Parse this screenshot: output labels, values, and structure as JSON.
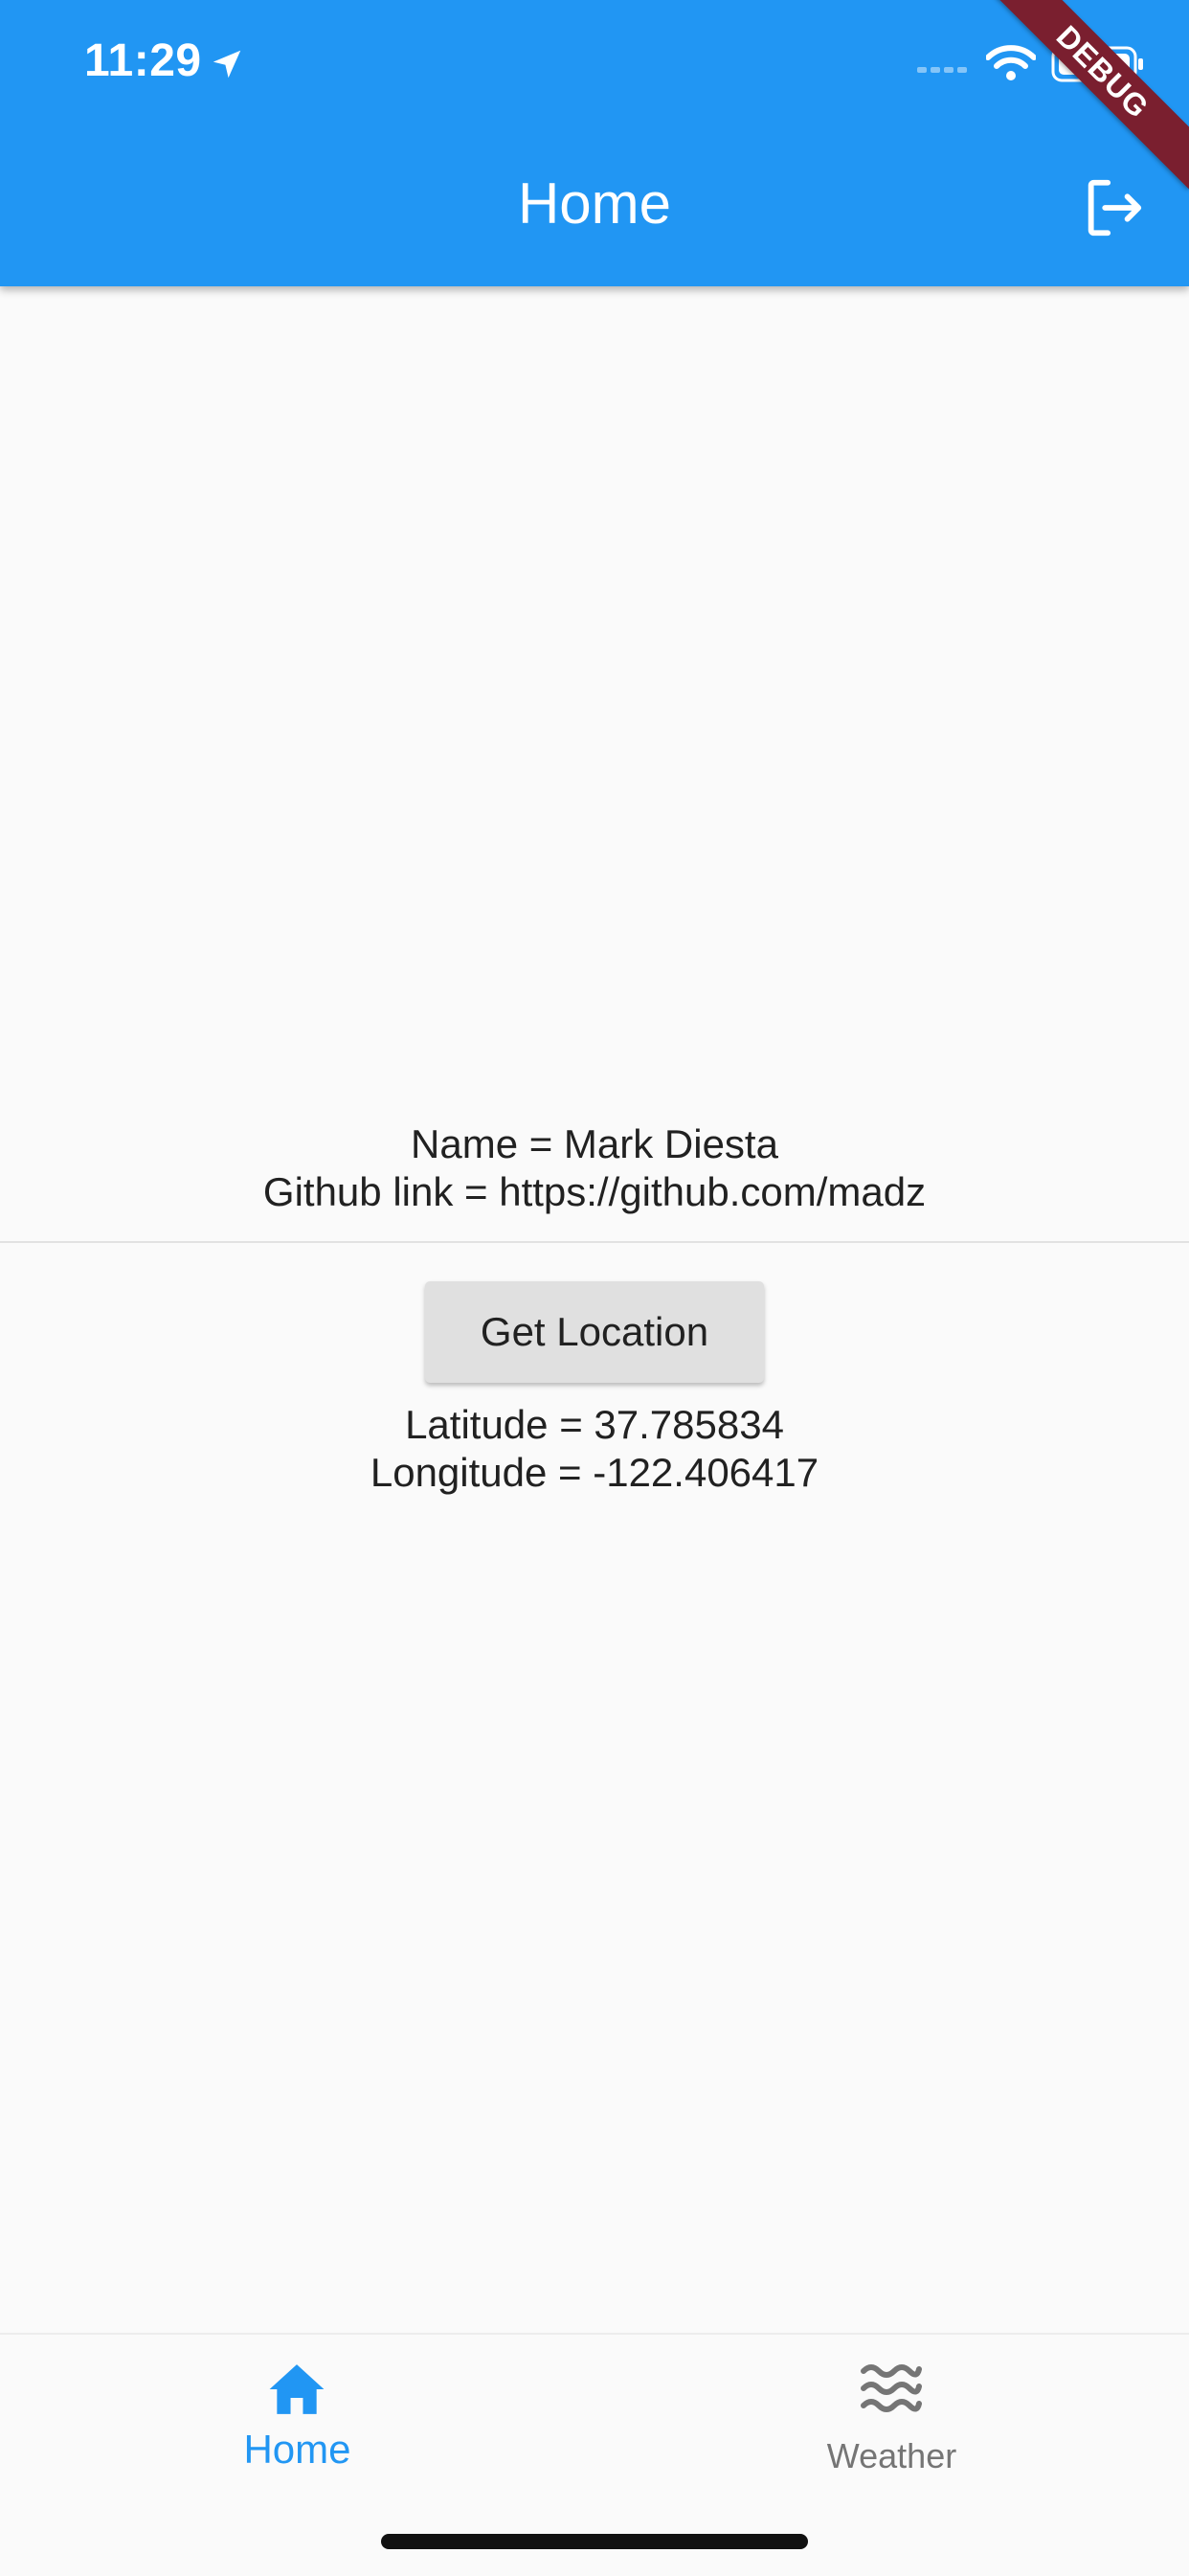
{
  "status_bar": {
    "time": "11:29"
  },
  "debug_banner": "DEBUG",
  "appbar": {
    "title": "Home"
  },
  "profile": {
    "name_line": "Name = Mark Diesta",
    "github_line": "Github link = https://github.com/madz"
  },
  "location": {
    "button_label": "Get Location",
    "latitude_line": "Latitude = 37.785834",
    "longitude_line": "Longitude = -122.406417"
  },
  "bottom_nav": {
    "items": [
      {
        "label": "Home",
        "icon": "home-icon",
        "selected": true
      },
      {
        "label": "Weather",
        "icon": "waves-icon",
        "selected": false
      }
    ]
  },
  "colors": {
    "primary": "#2196f3",
    "background": "#fafafa",
    "button": "#e0e0e0",
    "debug": "#7a1f2f",
    "inactive": "#757575"
  }
}
